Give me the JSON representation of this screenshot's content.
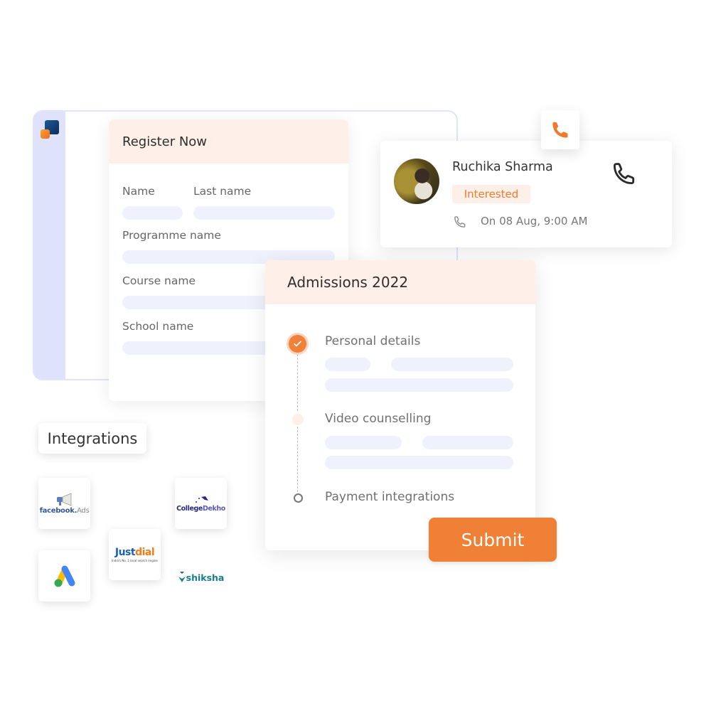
{
  "app": {
    "logo_icon": "app-logo-icon"
  },
  "register": {
    "title": "Register Now",
    "fields": {
      "name": "Name",
      "last_name": "Last name",
      "programme": "Programme name",
      "course": "Course name",
      "school": "School name"
    }
  },
  "contact": {
    "name": "Ruchika Sharma",
    "status": "Interested",
    "call_time": "On 08 Aug, 9:00 AM",
    "icons": {
      "call_tile": "phone-icon",
      "call_action": "phone-icon",
      "call_log": "phone-icon"
    }
  },
  "admissions": {
    "title": "Admissions 2022",
    "steps": [
      {
        "label": "Personal details",
        "state": "completed"
      },
      {
        "label": "Video counselling",
        "state": "current"
      },
      {
        "label": "Payment integrations",
        "state": "upcoming"
      }
    ],
    "submit_label": "Submit"
  },
  "integrations": {
    "title": "Integrations",
    "logos": [
      {
        "name": "facebook",
        "suffix": "Ads"
      },
      {
        "name": "College",
        "suffix": "Dekho"
      },
      {
        "name": "Google Ads"
      },
      {
        "name": "Just",
        "suffix": "dial",
        "tagline": "India's No. 1 local search engine"
      },
      {
        "name": "shiksha"
      }
    ]
  },
  "colors": {
    "accent": "#f08035",
    "header_tint": "#fef0e9",
    "placeholder_pill": "#eff2fd",
    "sidebar": "#dfe2fb"
  }
}
